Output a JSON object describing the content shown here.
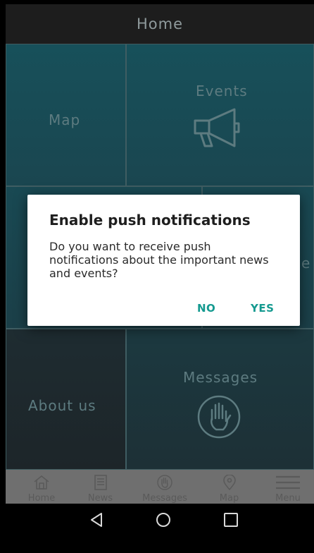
{
  "header": {
    "title": "Home"
  },
  "tiles": {
    "map": "Map",
    "events": "Events",
    "about": "About us",
    "messages": "Messages",
    "partial_right": "e"
  },
  "dialog": {
    "title": "Enable push notifications",
    "message": "Do you want to receive push notifications about the important news and events?",
    "no": "NO",
    "yes": "YES"
  },
  "tabbar": {
    "items": [
      {
        "label": "Home",
        "icon": "home-icon"
      },
      {
        "label": "News",
        "icon": "news-icon"
      },
      {
        "label": "Messages",
        "icon": "hand-icon"
      },
      {
        "label": "Map",
        "icon": "map-pin-icon"
      },
      {
        "label": "Menu",
        "icon": "menu-icon"
      }
    ]
  },
  "navbar": {
    "icons": [
      "back-icon",
      "home-circle-icon",
      "recents-icon"
    ]
  },
  "colors": {
    "accent": "#159a90",
    "header_bg": "#1d1d1d",
    "tabbar_bg": "#6f6f6f"
  }
}
